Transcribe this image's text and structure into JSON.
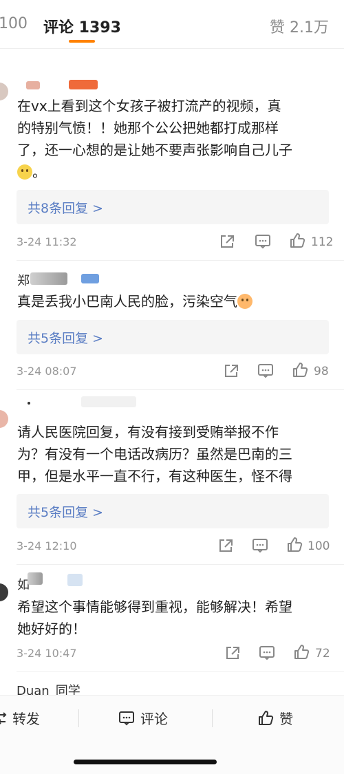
{
  "tabs": {
    "repost": "100",
    "comments": "评论 1393",
    "likes": "赞 2.1万"
  },
  "comments": [
    {
      "text_line1": "在vx上看到这个女孩子被打流产的视频，真",
      "text_line2": "的特别气愤！！她那个公公把她都打成那样",
      "text_line3": "了，还一心想的是让她不要声张影响自己儿子",
      "text_tail": "。",
      "replies": "共8条回复 >",
      "time": "3-24 11:32",
      "likes": "112"
    },
    {
      "name_char": "郑",
      "text": "真是丢我小巴南人民的脸，污染空气",
      "replies": "共5条回复 >",
      "time": "3-24 08:07",
      "likes": "98"
    },
    {
      "text_line1": "请人民医院回复，有没有接到受贿举报不作",
      "text_line2": "为？有没有一个电话改病历？虽然是巴南的三",
      "text_line3": "甲，但是水平一直不行，有这种医生，怪不得",
      "replies": "共5条回复 >",
      "time": "3-24 12:10",
      "likes": "100"
    },
    {
      "name_char": "如",
      "text_line1": "希望这个事情能够得到重视，能够解决！希望",
      "text_line2": "她好好的！",
      "time": "3-24 10:47",
      "likes": "72"
    },
    {
      "name_partial": "Duan_同学"
    }
  ],
  "bottom": {
    "repost": "转发",
    "comment": "评论",
    "like": "赞"
  },
  "colors": {
    "accent": "#ff8200",
    "link": "#5b7ec4"
  }
}
